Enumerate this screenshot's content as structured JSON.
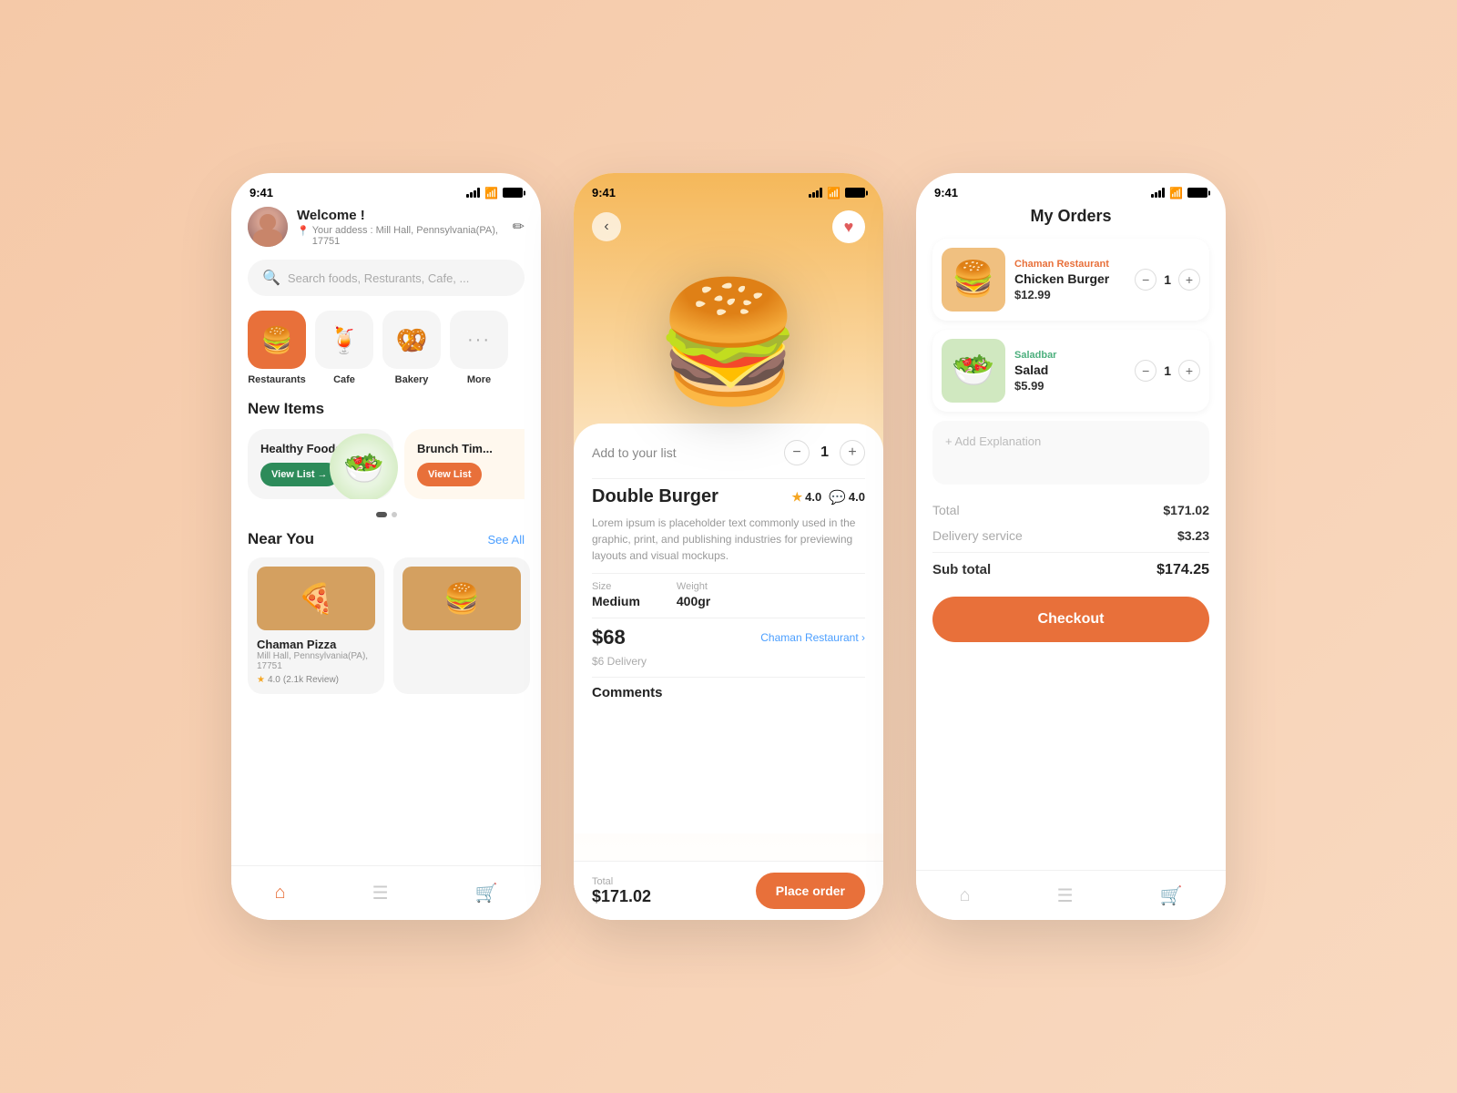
{
  "left_phone": {
    "status_time": "9:41",
    "welcome": "Welcome !",
    "address": "Your addess : Mill Hall, Pennsylvania(PA), 17751",
    "search_placeholder": "Search foods, Resturants, Cafe, ...",
    "categories": [
      {
        "label": "Restaurants",
        "icon": "🍔",
        "active": true
      },
      {
        "label": "Cafe",
        "icon": "🍹",
        "active": false
      },
      {
        "label": "Bakery",
        "icon": "🥨",
        "active": false
      },
      {
        "label": "More",
        "icon": "···",
        "active": false
      }
    ],
    "new_items_title": "New Items",
    "cards": [
      {
        "name": "Healthy Foods",
        "btn": "View List →",
        "btn_color": "green"
      },
      {
        "name": "Brunch Tim...",
        "btn": "View List",
        "btn_color": "orange"
      }
    ],
    "near_you_title": "Near You",
    "see_all": "See All",
    "restaurants": [
      {
        "name": "Chaman Pizza",
        "location": "Mill Hall, Pennsylvania(PA), 17751",
        "rating": "4.0",
        "rating_count": "(2.1k Review)"
      }
    ],
    "nav": [
      "home",
      "list",
      "cart"
    ]
  },
  "center_phone": {
    "status_time": "9:41",
    "product_name": "Double Burger",
    "rating_star": "4.0",
    "rating_chat": "4.0",
    "description": "Lorem ipsum is placeholder text commonly used in the graphic, print, and publishing industries for previewing layouts and visual mockups.",
    "size_label": "Size",
    "size_value": "Medium",
    "weight_label": "Weight",
    "weight_value": "400gr",
    "price": "$68",
    "delivery": "$6 Delivery",
    "restaurant": "Chaman Restaurant",
    "comments": "Comments",
    "add_to_list": "Add to your list",
    "quantity": "1",
    "total_label": "Total",
    "total_amount": "$171.02",
    "place_order_btn": "Place order"
  },
  "right_phone": {
    "status_time": "9:41",
    "title": "My Orders",
    "items": [
      {
        "restaurant": "Chaman Restaurant",
        "restaurant_color": "orange",
        "name": "Chicken Burger",
        "price": "$12.99",
        "quantity": "1"
      },
      {
        "restaurant": "Saladbar",
        "restaurant_color": "green",
        "name": "Salad",
        "price": "$5.99",
        "quantity": "1"
      }
    ],
    "add_explanation_placeholder": "+ Add Explanation",
    "total_label": "Total",
    "total_value": "$171.02",
    "delivery_label": "Delivery service",
    "delivery_value": "$3.23",
    "subtotal_label": "Sub total",
    "subtotal_value": "$174.25",
    "checkout_btn": "Checkout",
    "nav": [
      "home",
      "list",
      "cart"
    ]
  }
}
